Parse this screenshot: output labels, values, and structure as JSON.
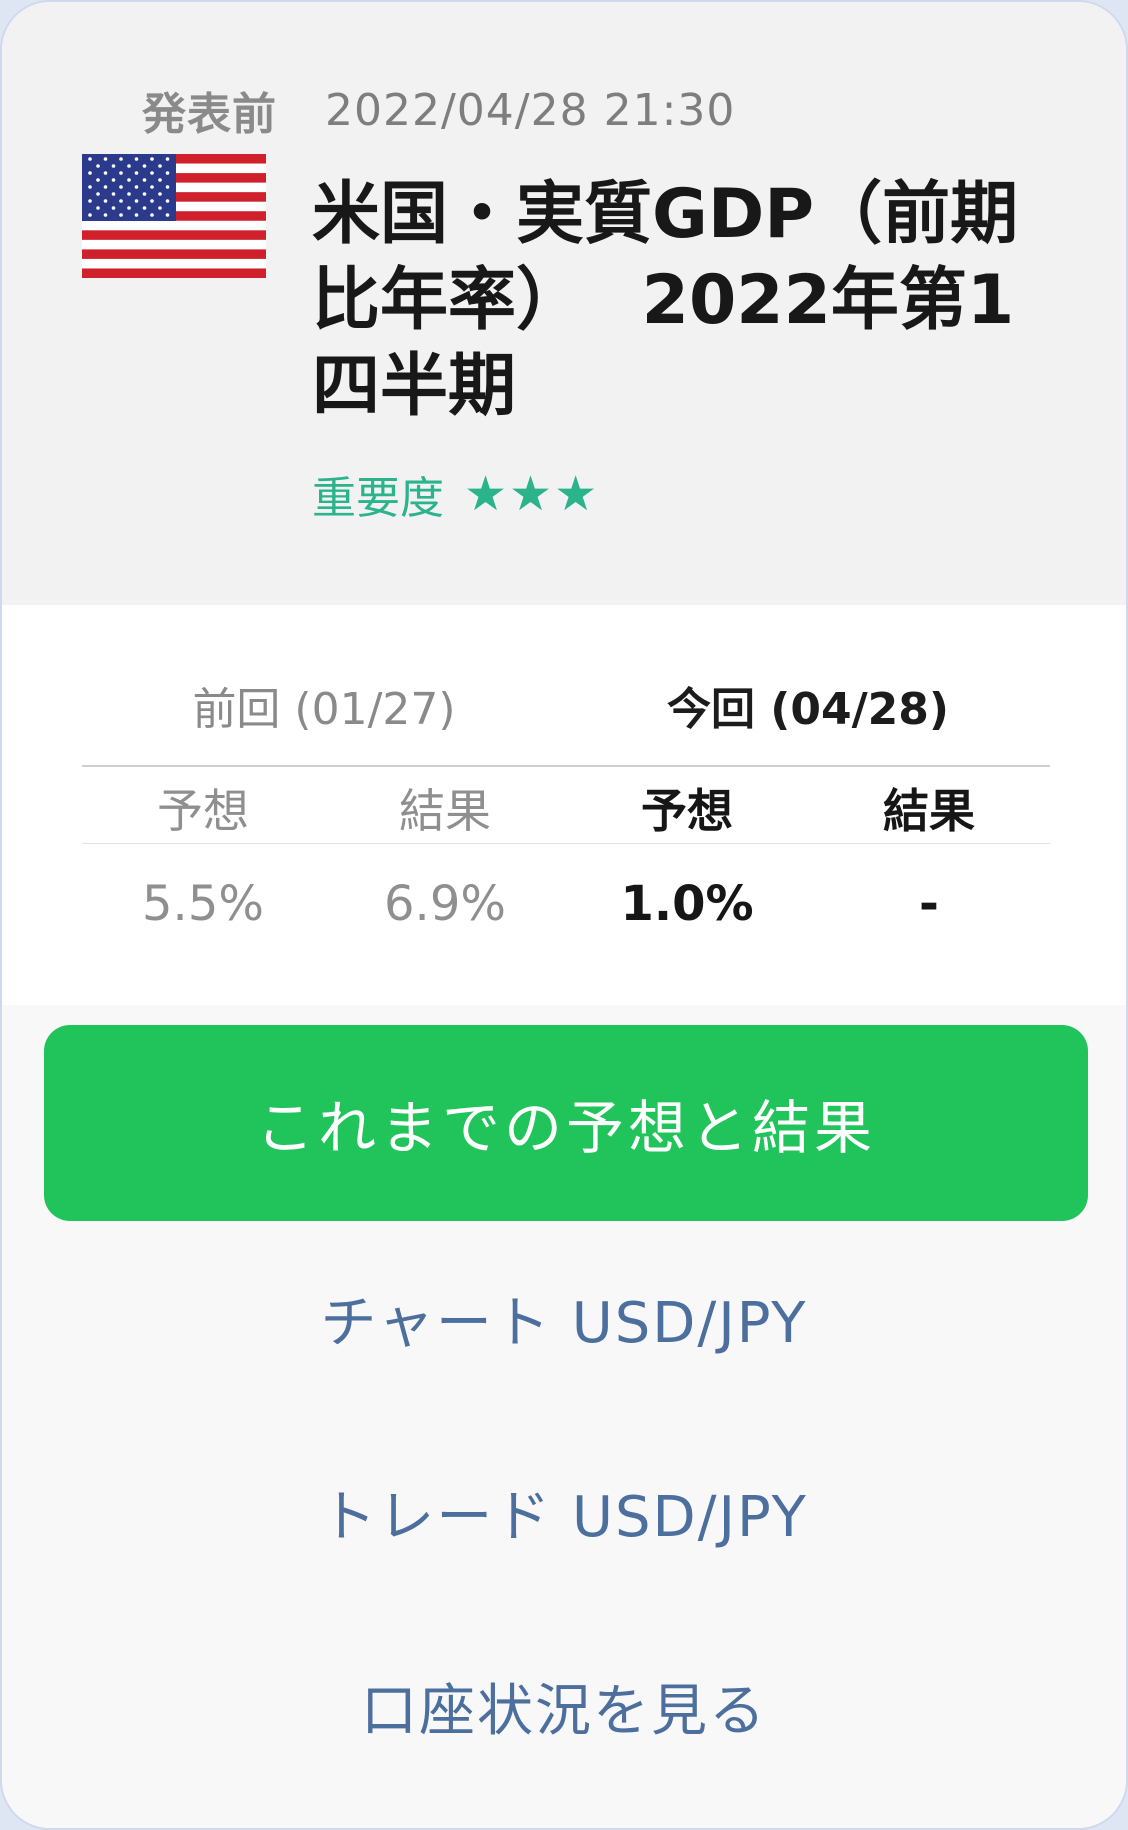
{
  "status": {
    "label": "発表前",
    "datetime": "2022/04/28 21:30"
  },
  "event": {
    "country_flag": "us-flag-icon",
    "title": "米国・実質GDP（前期\n比年率）　 2022年第1\n四半期",
    "importance_label": "重要度",
    "importance_stars": "★★★",
    "importance_rating": 3
  },
  "table": {
    "previous": {
      "header": "前回 (01/27)",
      "forecast_label": "予想",
      "result_label": "結果",
      "forecast": "5.5%",
      "result": "6.9%"
    },
    "current": {
      "header": "今回 (04/28)",
      "forecast_label": "予想",
      "result_label": "結果",
      "forecast": "1.0%",
      "result": "-"
    }
  },
  "actions": {
    "history_button": "これまでの予想と結果",
    "chart_link": "チャート USD/JPY",
    "trade_link": "トレード USD/JPY",
    "account_link": "口座状況を見る"
  },
  "colors": {
    "accent_green": "#21c45a",
    "importance_green": "#2bb38c",
    "link_blue": "#4d6f9e"
  }
}
